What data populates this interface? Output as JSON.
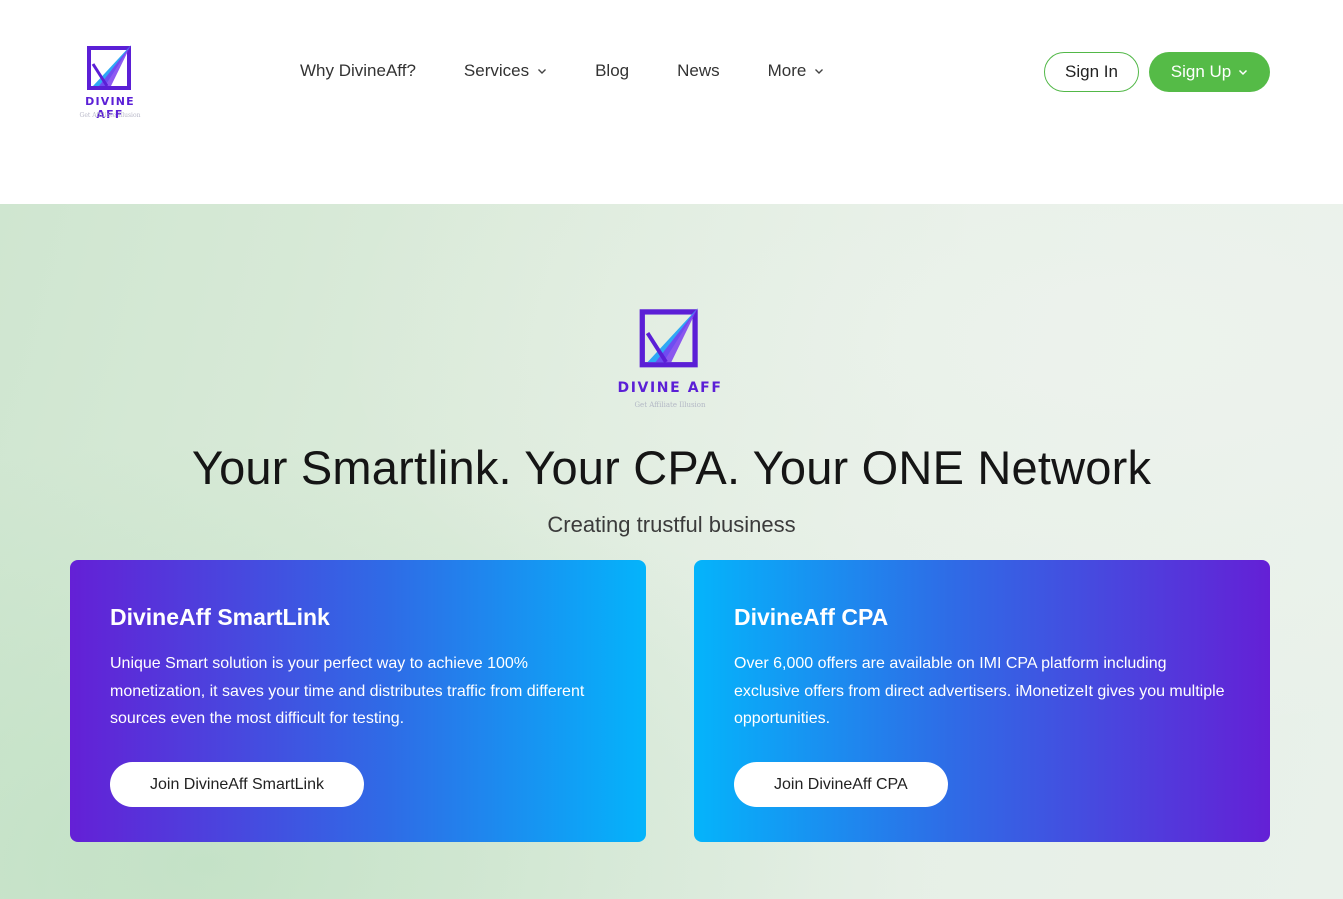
{
  "brand": {
    "name": "DIVINE AFF",
    "tagline": "Get Affiliate Illusion",
    "colors": {
      "primary": "#5b1fd6",
      "accent": "#2fa8f5",
      "green": "#55bb47"
    }
  },
  "nav": {
    "items": [
      {
        "label": "Why DivineAff?",
        "has_dropdown": false
      },
      {
        "label": "Services",
        "has_dropdown": true,
        "icon": "chevron-down-icon"
      },
      {
        "label": "Blog",
        "has_dropdown": false
      },
      {
        "label": "News",
        "has_dropdown": false
      },
      {
        "label": "More",
        "has_dropdown": true,
        "icon": "chevron-down-icon"
      }
    ]
  },
  "auth": {
    "sign_in_label": "Sign In",
    "sign_up_label": "Sign Up",
    "sign_up_icon": "chevron-down-icon"
  },
  "hero": {
    "headline": "Your Smartlink. Your CPA. Your ONE Network",
    "subline": "Creating trustful business"
  },
  "cards": [
    {
      "title": "DivineAff SmartLink",
      "text": "Unique Smart solution is your perfect way to achieve 100% monetization, it saves your time and distributes traffic from different sources even the most difficult for testing.",
      "button_label": "Join DivineAff SmartLink"
    },
    {
      "title": "DivineAff CPA",
      "text": "Over 6,000 offers are available on IMI CPA platform including exclusive offers from direct advertisers. iMonetizeIt gives you multiple opportunities.",
      "button_label": "Join DivineAff CPA"
    }
  ]
}
